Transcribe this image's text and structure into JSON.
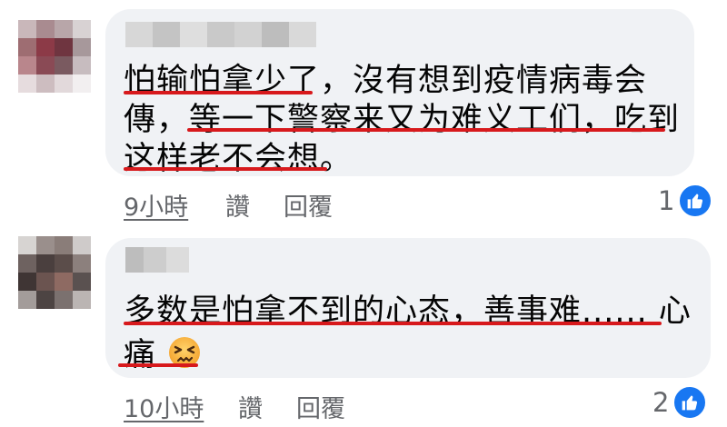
{
  "comments": [
    {
      "lines": [
        "怕输怕拿少了，沒有想到疫情病毒会",
        "傳，等一下警察来又为难义工们，吃到",
        "这样老不会想。"
      ],
      "time": "9小時",
      "like_label": "讚",
      "reply_label": "回覆",
      "reaction_count": "1",
      "reaction_icon": "like-icon"
    },
    {
      "lines": [
        "多数是怕拿不到的心态，善事难...... 心",
        "痛"
      ],
      "time": "10小時",
      "like_label": "讚",
      "reply_label": "回覆",
      "reaction_count": "2",
      "reaction_icon": "like-icon",
      "emoji": "confounded-face"
    }
  ],
  "colors": {
    "bubble": "#f0f2f5",
    "underline": "#d7191c",
    "like_blue": "#1877f2",
    "meta_gray": "#65676b"
  }
}
